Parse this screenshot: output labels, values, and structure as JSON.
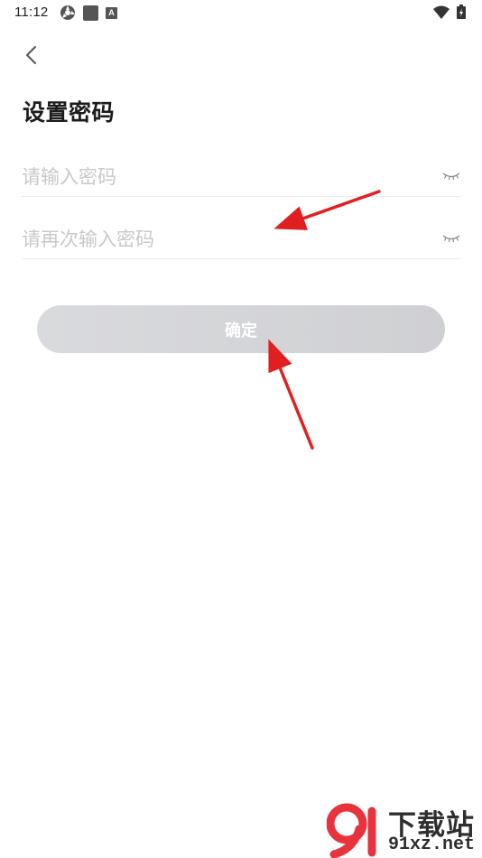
{
  "status_bar": {
    "time": "11:12",
    "icons_left": [
      "sync-icon",
      "square-icon",
      "a-icon"
    ],
    "a_icon_letter": "A",
    "icons_right": [
      "wifi-icon",
      "battery-icon"
    ]
  },
  "header": {
    "back_icon": "chevron-left-icon",
    "title": "设置密码"
  },
  "form": {
    "password_placeholder": "请输入密码",
    "confirm_password_placeholder": "请再次输入密码",
    "eye_icon": "closed-eye-icon"
  },
  "confirm_button": {
    "label": "确定"
  },
  "annotations": {
    "arrow_color": "#e02020",
    "count": 2
  },
  "watermark": {
    "logo_text": "91",
    "brand_cn": "下载站",
    "url": "91xz.net",
    "accent": "#e8323c"
  }
}
